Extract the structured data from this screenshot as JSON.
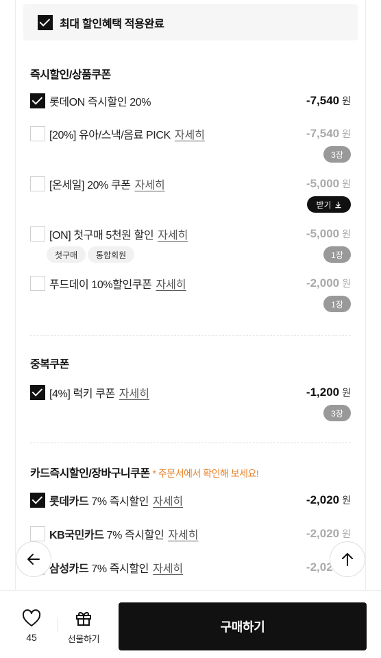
{
  "banner": {
    "label": "최대 할인혜택 적용완료"
  },
  "sections": {
    "instant": {
      "title": "즉시할인/상품쿠폰"
    },
    "duplicate": {
      "title": "중복쿠폰"
    },
    "card": {
      "title": "카드즉시할인/장바구니쿠폰",
      "note": "* 주문서에서 확인해 보세요!"
    }
  },
  "currency": "원",
  "detail_label": "자세히",
  "coupons": [
    {
      "name": "롯데ON 즉시할인 20%",
      "amount": "-7,540",
      "checked": true
    },
    {
      "name": "[20%] 유아/스낵/음료 PICK",
      "amount": "-7,540",
      "qty": "3장",
      "checked": false
    },
    {
      "name": "[온세일] 20% 쿠폰",
      "amount": "-5,000",
      "receive": "받기",
      "checked": false
    },
    {
      "name": "[ON] 첫구매 5천원 할인",
      "amount": "-5,000",
      "qty": "1장",
      "tags": [
        "첫구매",
        "통합회원"
      ],
      "checked": false
    },
    {
      "name": "푸드데이 10%할인쿠폰",
      "amount": "-2,000",
      "qty": "1장",
      "checked": false
    },
    {
      "name": "[4%] 럭키 쿠폰",
      "amount": "-1,200",
      "qty": "3장",
      "checked": true
    },
    {
      "name_bold": "롯데카드",
      "name_rest": "7% 즉시할인",
      "amount": "-2,020",
      "checked": true
    },
    {
      "name_bold": "KB국민카드",
      "name_rest": "7% 즉시할인",
      "amount": "-2,020",
      "checked": false
    },
    {
      "name_bold": "삼성카드",
      "name_rest": "7% 즉시할인",
      "amount": "-2,020",
      "checked": false
    }
  ],
  "bottom": {
    "wish_count": "45",
    "gift_label": "선물하기",
    "buy_label": "구매하기"
  },
  "icons": {
    "back": "arrow-left-icon",
    "top": "arrow-up-icon",
    "wish": "heart-icon",
    "gift": "gift-icon",
    "download": "download-icon"
  },
  "colors": {
    "note": "#e8822a",
    "primary": "#111111",
    "disabled": "#aaaaaa"
  }
}
